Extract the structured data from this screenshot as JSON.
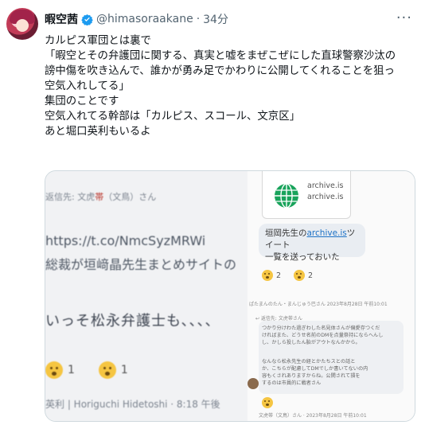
{
  "tweet": {
    "author_name": "暇空茜",
    "handle": "@himasoraakane",
    "separator": "·",
    "time": "34分",
    "more_icon": "more-horizontal-icon",
    "verified_color": "#1d9bf0",
    "body_lines": [
      "カルピス軍団とは裏で",
      "「暇空とその弁護団に関する、真実と嘘をまぜこぜにした直球警察沙汰の誹",
      "謗中傷を吹き込んで、誰かが勇み足でかわりに公開してくれることを狙って",
      "空気入れしてる」",
      "集団のことです",
      "空気入れてる幹部は「カルピス、スコール、文京区」",
      "あと堀口英利もいるよ"
    ]
  },
  "media": {
    "left": {
      "header_prefix": "返信先: 文虎",
      "header_emoji": "帯",
      "header_suffix": "（文鳥）さん",
      "link": "https://t.co/NmcSyzMRWi",
      "jp_line": "総裁が垣﨑晶先生まとめサイトの",
      "big_line": "いっそ松永弁護士も、、、、",
      "react_count_1": "1",
      "react_count_2": "1",
      "footer": "英利 | Horiguchi Hidetoshi · 8:18 午後"
    },
    "right": {
      "archive_1": "archive.is",
      "archive_2": "archive.is",
      "bubble_prefix": "垣岡先生の",
      "bubble_link": "archive.is",
      "bubble_suffix": "ツイート",
      "bubble_line2": "一覧を送っておいた",
      "react_count_1": "2",
      "react_count_2": "2",
      "meta_1": "ぱたまんのたん・まんじゅう巴さん 2023年8月28日 午前10:01",
      "reply_to": "↩ 返信先: 文虎帯さん",
      "small_1": "つかり分けわた過ぎわした名見体さんが偏愛存つくだ",
      "small_2": "ければまた、どうせ名前のDMを点量祭持にならへんし",
      "small_3": "し、かしら投したん胎がアウトなんかから。",
      "small_4": "なんなら松永先生の経とかたちスとの話と",
      "small_5": "か、こちらが配慮してDMでしか書いてないの内",
      "small_6": "容もくされありますからね。公開されて損を",
      "small_7": "するのは市員的に戦者さん",
      "meta_2": "文虎帯（文鳥）さん · 2023年8月28日 午前10:01"
    }
  }
}
